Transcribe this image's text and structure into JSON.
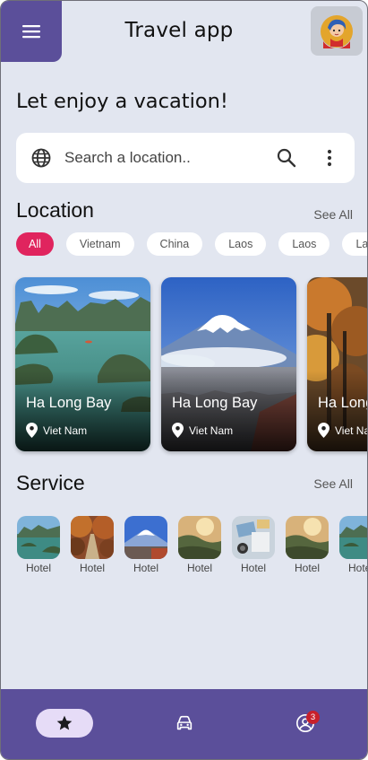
{
  "header": {
    "title": "Travel app",
    "menu_icon": "menu-icon",
    "avatar_icon": "user-avatar"
  },
  "headline": "Let enjoy a vacation!",
  "search": {
    "placeholder": "Search a location..",
    "leading_icon": "globe-icon",
    "trailing_icons": [
      "search-icon",
      "more-vert-icon"
    ]
  },
  "location_section": {
    "title": "Location",
    "see_all": "See All",
    "filters": [
      {
        "label": "All",
        "active": true
      },
      {
        "label": "Vietnam",
        "active": false
      },
      {
        "label": "China",
        "active": false
      },
      {
        "label": "Laos",
        "active": false
      },
      {
        "label": "Laos",
        "active": false
      },
      {
        "label": "Laos",
        "active": false
      }
    ],
    "cards": [
      {
        "name": "Ha Long Bay",
        "country": "Viet Nam"
      },
      {
        "name": "Ha Long Bay",
        "country": "Viet Nam"
      },
      {
        "name": "Ha Long Bay",
        "country": "Viet Nam"
      }
    ]
  },
  "service_section": {
    "title": "Service",
    "see_all": "See All",
    "items": [
      {
        "label": "Hotel"
      },
      {
        "label": "Hotel"
      },
      {
        "label": "Hotel"
      },
      {
        "label": "Hotel"
      },
      {
        "label": "Hotel"
      },
      {
        "label": "Hotel"
      },
      {
        "label": "Hotel"
      }
    ]
  },
  "bottom_nav": {
    "items": [
      "star-icon",
      "car-icon",
      "profile-icon"
    ],
    "notification_count": "3"
  },
  "colors": {
    "primary": "#5b4f9a",
    "background": "#e2e6f0",
    "chip_active": "#e0245e",
    "nav_pill": "#e6dcf7",
    "badge": "#c8202b"
  }
}
